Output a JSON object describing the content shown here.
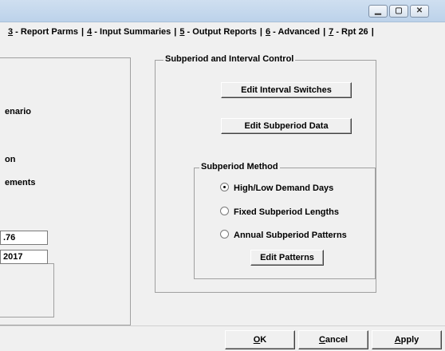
{
  "window": {
    "buttons": [
      "minimize",
      "maximize",
      "close"
    ]
  },
  "tabs": [
    {
      "hot": "3",
      "rest": " - Report Parms"
    },
    {
      "hot": "4",
      "rest": " - Input Summaries"
    },
    {
      "hot": "5",
      "rest": " - Output Reports"
    },
    {
      "hot": "6",
      "rest": " - Advanced"
    },
    {
      "hot": "7",
      "rest": " - Rpt 26"
    }
  ],
  "left": {
    "labels": [
      "enario",
      "on",
      "ements"
    ],
    "field1": ".76",
    "field2": "2017"
  },
  "subperiod": {
    "group_title": "Subperiod and Interval Control",
    "edit_interval_label": "Edit Interval Switches",
    "edit_subperiod_label": "Edit Subperiod Data",
    "method_title": "Subperiod Method",
    "options": [
      {
        "label": "High/Low Demand Days",
        "selected": true
      },
      {
        "label": "Fixed Subperiod Lengths",
        "selected": false
      },
      {
        "label": "Annual Subperiod Patterns",
        "selected": false
      }
    ],
    "edit_patterns_label": "Edit Patterns"
  },
  "footer": {
    "ok": {
      "hot": "O",
      "rest": "K"
    },
    "cancel": {
      "hot": "C",
      "rest": "ancel"
    },
    "apply": {
      "hot": "A",
      "rest": "pply"
    }
  },
  "colors": {
    "titlebar": "#cfdff0",
    "face": "#f0f0f0"
  }
}
